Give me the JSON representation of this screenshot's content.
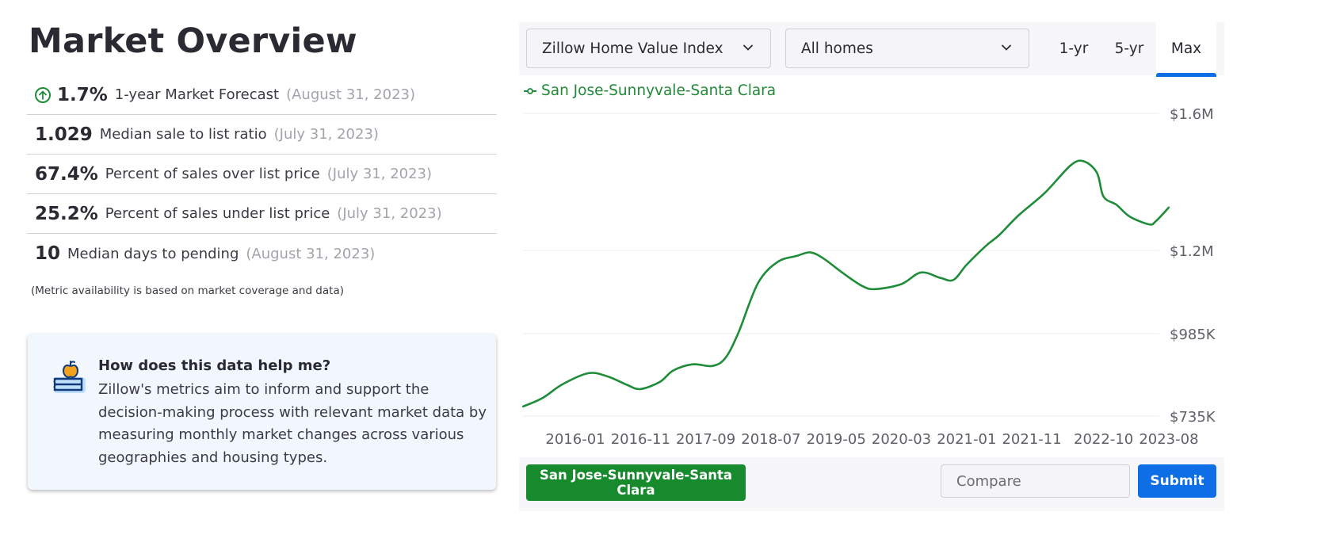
{
  "page": {
    "title": "Market Overview"
  },
  "metrics": [
    {
      "value": "1.7%",
      "label": "1-year Market Forecast",
      "date": "(August 31, 2023)",
      "icon": "arrow-up-circle-icon",
      "trend": "up"
    },
    {
      "value": "1.029",
      "label": "Median sale to list ratio",
      "date": "(July 31, 2023)"
    },
    {
      "value": "67.4%",
      "label": "Percent of sales over list price",
      "date": "(July 31, 2023)"
    },
    {
      "value": "25.2%",
      "label": "Percent of sales under list price",
      "date": "(July 31, 2023)"
    },
    {
      "value": "10",
      "label": "Median days to pending",
      "date": "(August 31, 2023)"
    }
  ],
  "note": "(Metric availability is based on market coverage and data)",
  "help": {
    "icon": "apple-on-books-icon",
    "title": "How does this data help me?",
    "body": "Zillow's metrics aim to inform and support the decision-making process with relevant market data by measuring monthly market changes across various geographies and housing types."
  },
  "controls": {
    "metric_select": "Zillow Home Value Index",
    "home_type_select": "All homes",
    "range_tabs": [
      "1-yr",
      "5-yr",
      "Max"
    ],
    "active_range": "Max"
  },
  "bottom": {
    "region_button": "San Jose-Sunnyvale-Santa Clara",
    "compare_placeholder": "Compare",
    "compare_value": "",
    "submit_label": "Submit"
  },
  "colors": {
    "series": "#1e8c39",
    "accent": "#0d6ee6",
    "region_button": "#168a2d"
  },
  "chart_data": {
    "type": "line",
    "title": "",
    "xlabel": "",
    "ylabel": "",
    "legend": {
      "entries": [
        "San Jose-Sunnyvale-Santa Clara"
      ],
      "position": "top-left"
    },
    "grid": true,
    "y_ticks": [
      {
        "value": 1600000,
        "label": "$1.6M"
      },
      {
        "value": 1200000,
        "label": "$1.2M"
      },
      {
        "value": 985000,
        "label": "$985K"
      },
      {
        "value": 735000,
        "label": "$735K"
      }
    ],
    "x_ticks": [
      "2016-01",
      "2016-11",
      "2017-09",
      "2018-07",
      "2019-05",
      "2020-03",
      "2021-01",
      "2021-11",
      "2022-10",
      "2023-08"
    ],
    "series": [
      {
        "name": "San Jose-Sunnyvale-Santa Clara",
        "x": [
          "2015-05",
          "2015-08",
          "2015-11",
          "2016-03",
          "2016-06",
          "2016-09",
          "2016-11",
          "2017-02",
          "2017-04",
          "2017-07",
          "2017-10",
          "2017-12",
          "2018-02",
          "2018-05",
          "2018-08",
          "2018-11",
          "2019-01",
          "2019-03",
          "2019-06",
          "2019-09",
          "2019-11",
          "2020-03",
          "2020-06",
          "2020-09",
          "2020-11",
          "2021-01",
          "2021-04",
          "2021-06",
          "2021-09",
          "2022-01",
          "2022-05",
          "2022-07",
          "2022-09",
          "2022-10",
          "2022-12",
          "2023-02",
          "2023-05",
          "2023-06",
          "2023-08"
        ],
        "values": [
          764000,
          790000,
          831000,
          865000,
          855000,
          829000,
          817000,
          839000,
          873000,
          892000,
          887000,
          911000,
          987000,
          1115000,
          1170000,
          1186000,
          1195000,
          1180000,
          1142000,
          1108000,
          1100000,
          1113000,
          1143000,
          1129000,
          1124000,
          1163000,
          1214000,
          1245000,
          1303000,
          1368000,
          1449000,
          1460000,
          1426000,
          1357000,
          1333000,
          1299000,
          1276000,
          1285000,
          1325000
        ]
      }
    ]
  }
}
